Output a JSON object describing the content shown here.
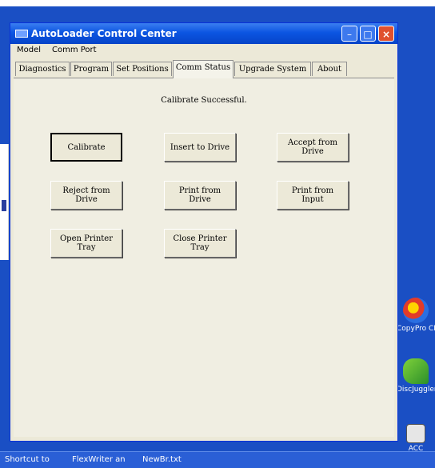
{
  "window": {
    "title": "AutoLoader Control Center",
    "controls": {
      "minimize": "–",
      "maximize": "□",
      "close": "×"
    }
  },
  "menu": [
    "Model",
    "Comm Port"
  ],
  "tabs": [
    {
      "label": "Diagnostics",
      "active": false
    },
    {
      "label": "Program",
      "active": false
    },
    {
      "label": "Set Positions",
      "active": false
    },
    {
      "label": "Comm Status",
      "active": true
    },
    {
      "label": "Upgrade System",
      "active": false
    },
    {
      "label": "About",
      "active": false
    }
  ],
  "status": "Calibrate Successful.",
  "buttons": {
    "calibrate": "Calibrate",
    "insert_to_drive": "Insert to Drive",
    "accept_from_drive": "Accept from\nDrive",
    "reject_from_drive": "Reject from\nDrive",
    "print_from_drive": "Print from\nDrive",
    "print_from_input": "Print from\nInput",
    "open_printer_tray": "Open Printer\nTray",
    "close_printer_tray": "Close Printer\nTray"
  },
  "desktop_icons": [
    {
      "label": "CopyPro CD Painter",
      "icon": "cd-painter-icon",
      "color": "#e23b2a"
    },
    {
      "label": "DiscJuggler",
      "icon": "discjuggler-icon",
      "color": "#3fae3a"
    },
    {
      "label": "ACC",
      "icon": "acc-icon",
      "color": "#e6e6e6"
    }
  ],
  "taskbar": [
    "Shortcut to",
    "FlexWriter an",
    "NewBr.txt"
  ]
}
